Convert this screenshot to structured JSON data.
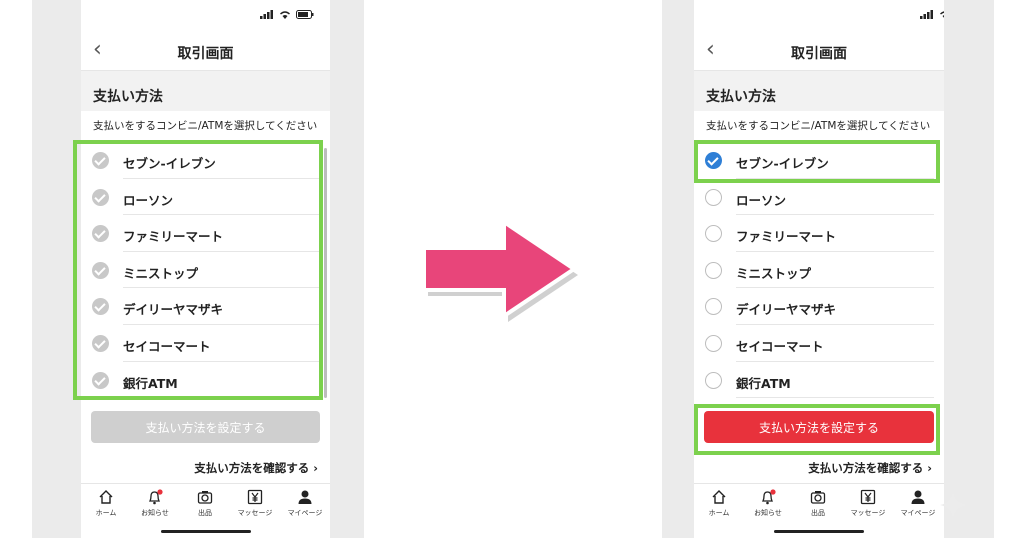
{
  "screen_title": "取引画面",
  "section_title": "支払い方法",
  "instruction": "支払いをするコンビニ/ATMを選択してください",
  "options": [
    {
      "label": "セブン-イレブン"
    },
    {
      "label": "ローソン"
    },
    {
      "label": "ファミリーマート"
    },
    {
      "label": "ミニストップ"
    },
    {
      "label": "デイリーヤマザキ"
    },
    {
      "label": "セイコーマート"
    },
    {
      "label": "銀行ATM"
    }
  ],
  "set_button_label": "支払い方法を設定する",
  "confirm_link": "支払い方法を確認する",
  "confirm_chevron": "›",
  "tabs": [
    {
      "label": "ホーム",
      "icon": "home-icon"
    },
    {
      "label": "お知らせ",
      "icon": "bell-icon"
    },
    {
      "label": "出品",
      "icon": "camera-icon"
    },
    {
      "label": "マッセージ",
      "icon": "yen-icon"
    },
    {
      "label": "マイページ",
      "icon": "person-icon"
    }
  ],
  "before": {
    "selected": "none",
    "button_state": "disabled"
  },
  "after": {
    "selected": "セブン-イレブン",
    "button_state": "enabled"
  },
  "colors": {
    "highlight_border": "#7cd14d",
    "arrow": "#e8457a",
    "active_button": "#e8323c",
    "disabled_button": "#cfcfcf",
    "check": "#2f7fd6",
    "badge": "#e8323c"
  }
}
